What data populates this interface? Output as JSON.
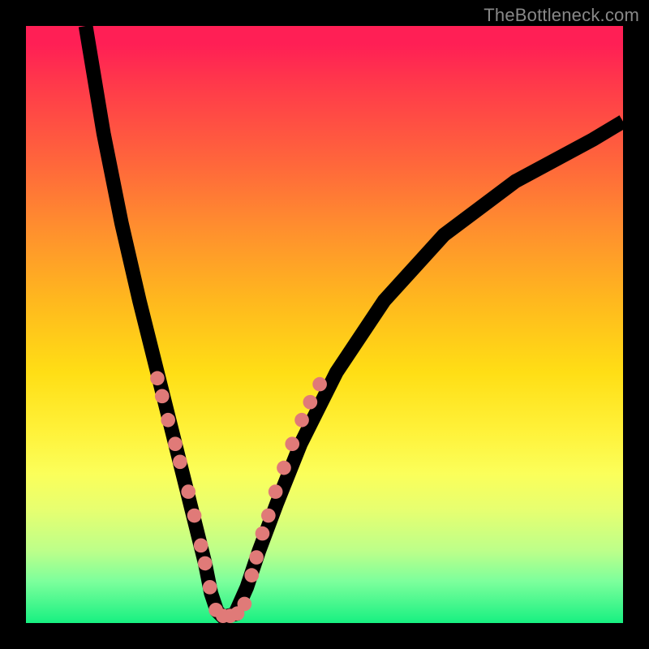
{
  "watermark": "TheBottleneck.com",
  "colors": {
    "frame": "#000000",
    "curve": "#000000",
    "dots": "#e07a78",
    "gradient_top": "#ff1f55",
    "gradient_bottom": "#17f081",
    "watermark_text": "#888888"
  },
  "chart_data": {
    "type": "line",
    "title": "",
    "xlabel": "",
    "ylabel": "",
    "xlim": [
      0,
      100
    ],
    "ylim": [
      0,
      100
    ],
    "grid": false,
    "note": "No axis ticks or numeric labels are rendered in the image; values are inferred on a 0–100 normalized scale.",
    "series": [
      {
        "name": "bottleneck-curve",
        "x": [
          10,
          13,
          16,
          19,
          22,
          24,
          26,
          28,
          30,
          31,
          32,
          33,
          35,
          37,
          39,
          42,
          46,
          52,
          60,
          70,
          82,
          95,
          100
        ],
        "y": [
          100,
          82,
          67,
          54,
          42,
          34,
          26,
          18,
          10,
          5,
          2,
          1,
          1.5,
          6,
          12,
          20,
          30,
          42,
          54,
          65,
          74,
          81,
          84
        ]
      }
    ],
    "marker_clusters": [
      {
        "name": "left-arm-dots",
        "points": [
          {
            "x": 22.0,
            "y": 41
          },
          {
            "x": 22.8,
            "y": 38
          },
          {
            "x": 23.8,
            "y": 34
          },
          {
            "x": 25.0,
            "y": 30
          },
          {
            "x": 25.8,
            "y": 27
          },
          {
            "x": 27.2,
            "y": 22
          },
          {
            "x": 28.2,
            "y": 18
          },
          {
            "x": 29.3,
            "y": 13
          },
          {
            "x": 30.0,
            "y": 10
          },
          {
            "x": 30.8,
            "y": 6
          }
        ]
      },
      {
        "name": "valley-dots",
        "points": [
          {
            "x": 31.8,
            "y": 2.2
          },
          {
            "x": 33.0,
            "y": 1.2
          },
          {
            "x": 34.2,
            "y": 1.2
          },
          {
            "x": 35.4,
            "y": 1.6
          },
          {
            "x": 36.6,
            "y": 3.2
          }
        ]
      },
      {
        "name": "right-arm-dots",
        "points": [
          {
            "x": 37.8,
            "y": 8
          },
          {
            "x": 38.6,
            "y": 11
          },
          {
            "x": 39.6,
            "y": 15
          },
          {
            "x": 40.6,
            "y": 18
          },
          {
            "x": 41.8,
            "y": 22
          },
          {
            "x": 43.2,
            "y": 26
          },
          {
            "x": 44.6,
            "y": 30
          },
          {
            "x": 46.2,
            "y": 34
          },
          {
            "x": 47.6,
            "y": 37
          },
          {
            "x": 49.2,
            "y": 40
          }
        ]
      }
    ]
  }
}
